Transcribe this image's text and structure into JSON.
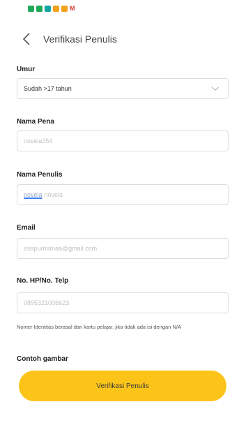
{
  "header": {
    "title": "Verifikasi Penulis"
  },
  "form": {
    "age": {
      "label": "Umur",
      "value": "Sudah >17 tahun"
    },
    "pen_name": {
      "label": "Nama Pena",
      "value": "novela354"
    },
    "writer_name": {
      "label": "Nama Penulis",
      "value_first": "novela",
      "value_second": "novela"
    },
    "email": {
      "label": "Email",
      "value": "esapurnamaa@gmail.com"
    },
    "phone": {
      "label": "No. HP/No. Telp",
      "value": "0895321006623"
    },
    "note": "Nomer Identitas berasal dari kartu pelajar, jika tidak ada isi dengan N/A",
    "example_label": "Contoh gambar"
  },
  "cta": {
    "label": "Verifikasi Penulis"
  },
  "colors": {
    "accent": "#fcc419",
    "statusbar_icons": [
      "#1faa59",
      "#1faa59",
      "#12a4a4",
      "#f2a21b",
      "#f2a21b"
    ]
  }
}
